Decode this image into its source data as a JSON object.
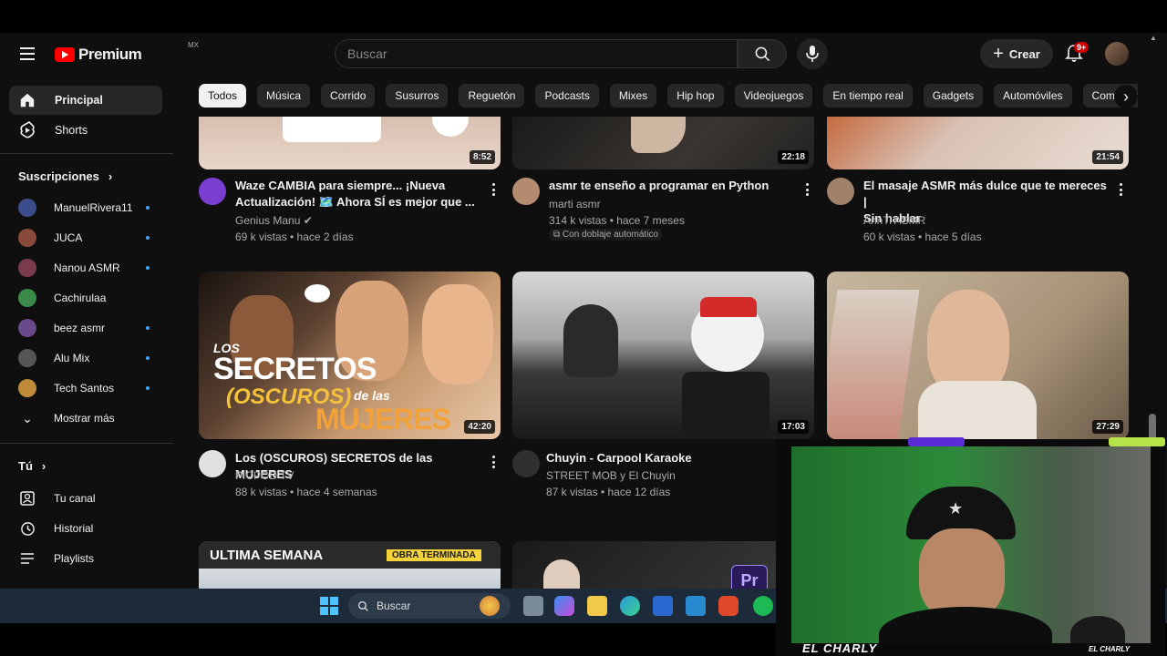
{
  "header": {
    "logo_text": "Premium",
    "region": "MX",
    "search_placeholder": "Buscar",
    "create_label": "Crear",
    "notifications_badge": "9+"
  },
  "sidebar": {
    "main": [
      {
        "label": "Principal",
        "icon": "home-icon",
        "active": true
      },
      {
        "label": "Shorts",
        "icon": "shorts-icon",
        "active": false
      }
    ],
    "subscriptions_title": "Suscripciones",
    "subscriptions": [
      {
        "name": "ManuelRivera11",
        "new": true,
        "color": "#3b4d8a"
      },
      {
        "name": "JUCA",
        "new": true,
        "color": "#8a4a3b"
      },
      {
        "name": "Nanou ASMR",
        "new": true,
        "color": "#7a3b4d"
      },
      {
        "name": "Cachirulaa",
        "new": false,
        "color": "#3b8a4a"
      },
      {
        "name": "beez asmr",
        "new": true,
        "color": "#6a4a8a"
      },
      {
        "name": "Alu Mix",
        "new": true,
        "color": "#555555"
      },
      {
        "name": "Tech Santos",
        "new": true,
        "color": "#c08a3b"
      }
    ],
    "show_more": "Mostrar más",
    "you_title": "Tú",
    "you_items": [
      {
        "label": "Tu canal",
        "icon": "channel-icon"
      },
      {
        "label": "Historial",
        "icon": "history-icon"
      },
      {
        "label": "Playlists",
        "icon": "playlists-icon"
      }
    ]
  },
  "chips": [
    "Todos",
    "Música",
    "Corrido",
    "Susurros",
    "Reguetón",
    "Podcasts",
    "Mixes",
    "Hip hop",
    "Videojuegos",
    "En tiempo real",
    "Gadgets",
    "Automóviles",
    "Comedias"
  ],
  "videos_row1": [
    {
      "title_line1": "Waze CAMBIA para siempre... ¡Nueva",
      "title_line2": "Actualización! 🗺️ Ahora SÍ es mejor que ...",
      "channel": "Genius Manu",
      "verified": true,
      "meta": "69 k vistas • hace 2 días",
      "duration": "8:52"
    },
    {
      "title_line1": "asmr te enseño a programar en Python",
      "title_line2": "",
      "channel": "marti asmr",
      "meta": "314 k vistas • hace 7 meses",
      "dub": "Con doblaje automático",
      "duration": "22:18"
    },
    {
      "title_line1": "El masaje ASMR más dulce que te mereces |",
      "title_line2": "Sin hablar",
      "channel": "AnnTi ASMR",
      "meta": "60 k vistas • hace 5 días",
      "duration": "21:54"
    }
  ],
  "videos_row2": [
    {
      "title": "Los (OSCUROS) SECRETOS de las MUJERES",
      "channel": "PICPOD TV",
      "meta": "88 k vistas • hace 4 semanas",
      "duration": "42:20",
      "thumb_text_1": "LOS",
      "thumb_text_2": "SECRETOS",
      "thumb_text_3": "(OSCUROS)",
      "thumb_text_4": "de las",
      "thumb_text_5": "MUJERES"
    },
    {
      "title": "Chuyin - Carpool Karaoke",
      "channel": "STREET MOB y El Chuyin",
      "meta": "87 k vistas • hace 12 días",
      "duration": "17:03"
    },
    {
      "title": "",
      "channel": "",
      "meta": "",
      "duration": "27:29"
    }
  ],
  "videos_row3": [
    {
      "thumb_text_left": "ULTIMA SEMANA",
      "thumb_text_right": "OBRA TERMINADA"
    },
    {
      "thumb_badge": "Pr"
    }
  ],
  "taskbar": {
    "search_label": "Buscar"
  },
  "webcam": {
    "name": "EL CHARLY",
    "tag": "EL CHARLY"
  },
  "colors": {
    "background": "#0f0f0f",
    "chip": "#272727",
    "brand_red": "#ff0000",
    "accent_blue": "#3ea6ff"
  }
}
